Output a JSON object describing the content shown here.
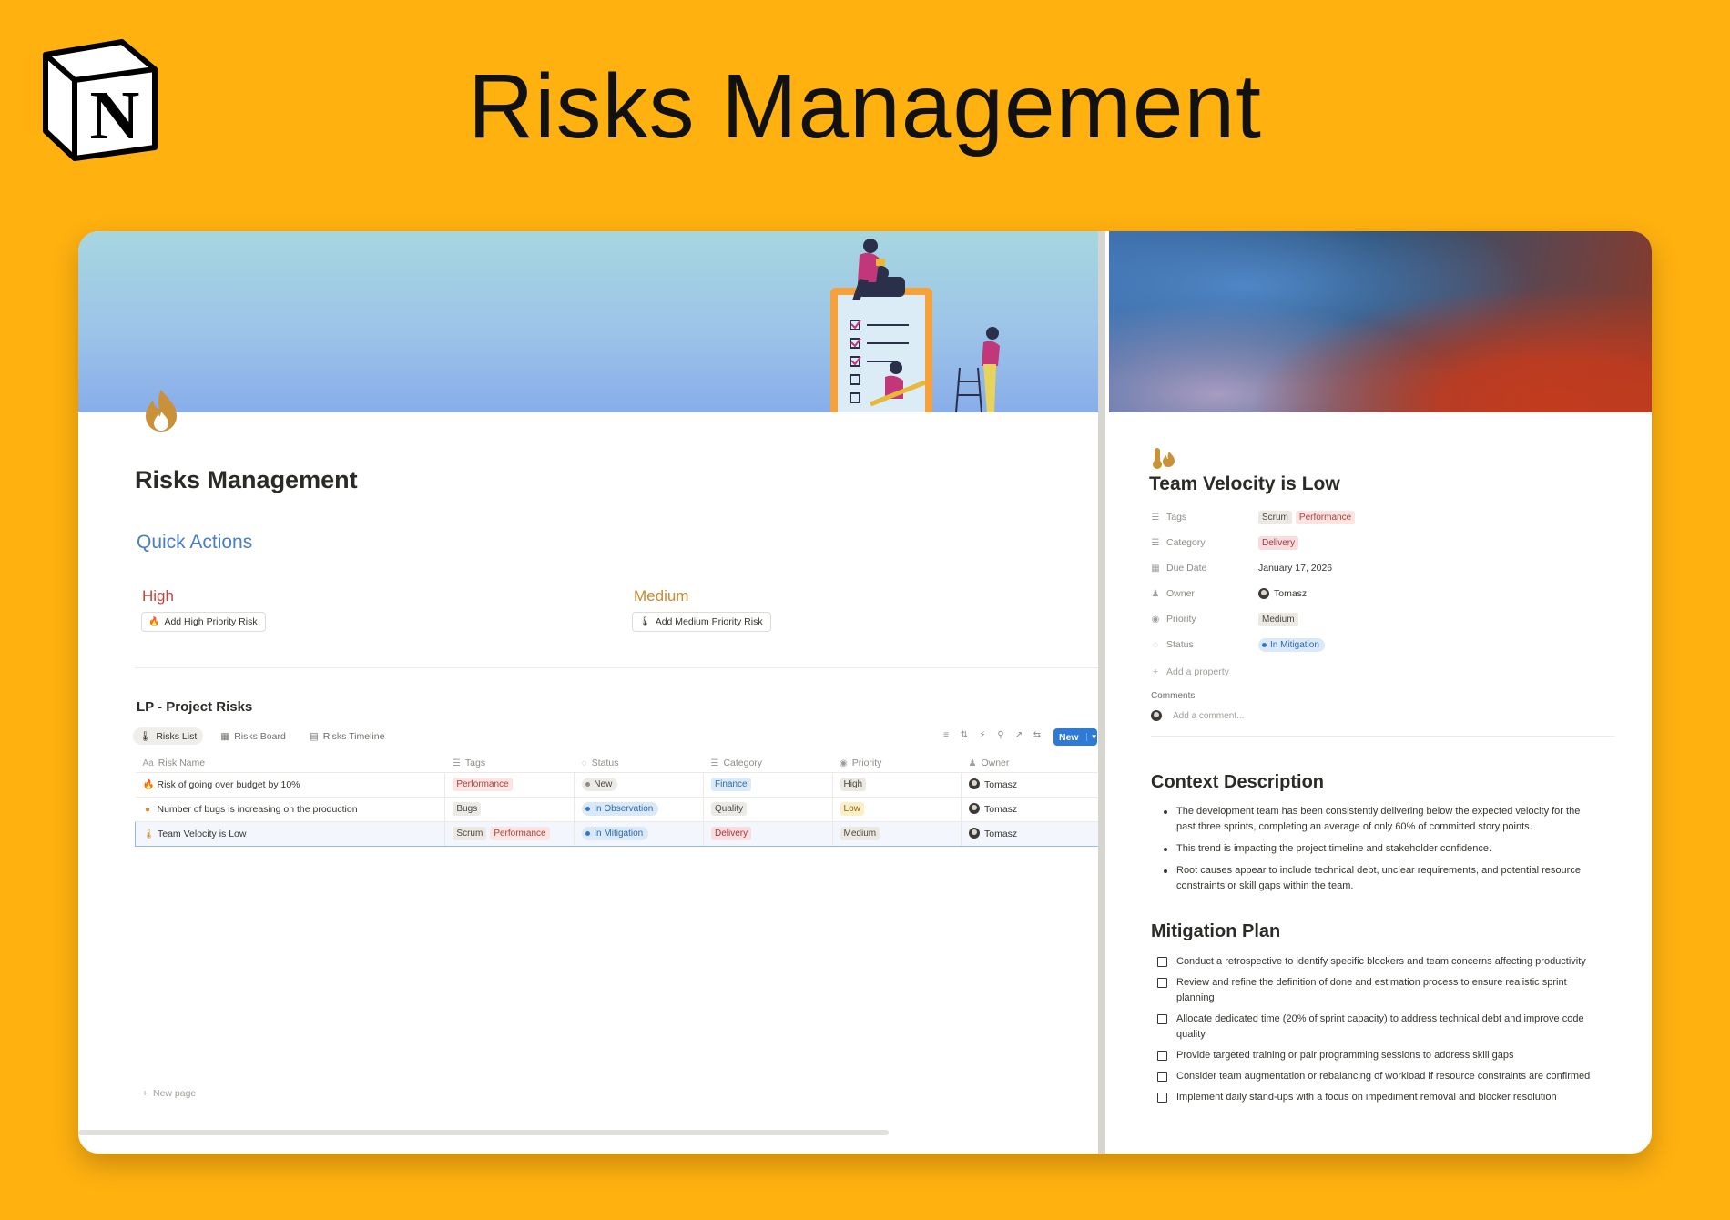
{
  "hero": {
    "title": "Risks Management"
  },
  "left": {
    "page_title": "Risks Management",
    "quick_actions": {
      "title": "Quick Actions",
      "high_label": "High",
      "high_button": "Add High Priority Risk",
      "medium_label": "Medium",
      "medium_button": "Add Medium Priority Risk"
    },
    "database": {
      "title": "LP - Project Risks",
      "views": [
        "Risks List",
        "Risks Board",
        "Risks Timeline"
      ],
      "new_button": "New",
      "columns": [
        "Risk Name",
        "Tags",
        "Status",
        "Category",
        "Priority",
        "Owner"
      ],
      "rows": [
        {
          "name": "Risk of going over budget by 10%",
          "tags": [
            "Performance"
          ],
          "status": "New",
          "category": "Finance",
          "priority": "High",
          "owner": "Tomasz"
        },
        {
          "name": "Number of bugs is increasing on the production",
          "tags": [
            "Bugs"
          ],
          "status": "In Observation",
          "category": "Quality",
          "priority": "Low",
          "owner": "Tomasz"
        },
        {
          "name": "Team Velocity is Low",
          "tags": [
            "Scrum",
            "Performance"
          ],
          "status": "In Mitigation",
          "category": "Delivery",
          "priority": "Medium",
          "owner": "Tomasz"
        }
      ],
      "new_page": "New page"
    }
  },
  "right": {
    "title": "Team Velocity is Low",
    "props": {
      "tags_label": "Tags",
      "tags": [
        "Scrum",
        "Performance"
      ],
      "category_label": "Category",
      "category": "Delivery",
      "due_label": "Due Date",
      "due": "January 17, 2026",
      "owner_label": "Owner",
      "owner": "Tomasz",
      "priority_label": "Priority",
      "priority": "Medium",
      "status_label": "Status",
      "status": "In Mitigation",
      "add_property": "Add a property"
    },
    "comments_label": "Comments",
    "comment_placeholder": "Add a comment...",
    "context_title": "Context Description",
    "context": [
      "The development team has been consistently delivering below the expected velocity for the past three sprints, completing an average of only 60% of committed story points.",
      "This trend is impacting the project timeline and stakeholder confidence.",
      "Root causes appear to include technical debt, unclear requirements, and potential resource constraints or skill gaps within the team."
    ],
    "mitigation_title": "Mitigation Plan",
    "mitigation": [
      "Conduct a retrospective to identify specific blockers and team concerns affecting productivity",
      "Review and refine the definition of done and estimation process to ensure realistic sprint planning",
      "Allocate dedicated time (20% of sprint capacity) to address technical debt and improve code quality",
      "Provide targeted training or pair programming sessions to address skill gaps",
      "Consider team augmentation or rebalancing of workload if resource constraints are confirmed",
      "Implement daily stand-ups with a focus on impediment removal and blocker resolution"
    ]
  },
  "colors": {
    "background": "#FFB110",
    "accent_blue": "#4a7dc6",
    "high": "#c2473a",
    "medium": "#c98a2d",
    "new_button": "#2f7ad6"
  }
}
